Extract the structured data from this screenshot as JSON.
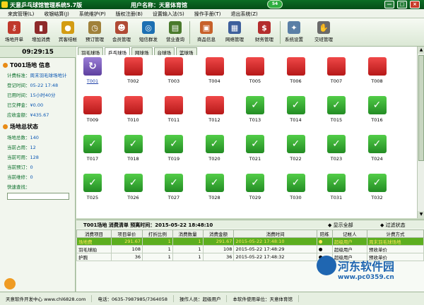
{
  "title": {
    "app": "天意乒乓球馆管理系统5.7版",
    "user": "用户名称：天意体育馆",
    "badge": "54",
    "min": "—",
    "max": "□",
    "close": "×"
  },
  "menu": [
    "来宾管理(L)",
    "收银结算(J)",
    "系统维护(P)",
    "版权注册(B)",
    "设置输入法(S)",
    "操作手册(T)",
    "退出系统(Z)"
  ],
  "toolbar": [
    {
      "label": "场地开单",
      "icon": "key-icon",
      "color": "#c0392b",
      "glyph": "⚷"
    },
    {
      "label": "增加消费",
      "icon": "bottle-icon",
      "color": "#8e2a2a",
      "glyph": "▮"
    },
    {
      "label": "宾客结帐",
      "icon": "coins-icon",
      "color": "#d39c13",
      "glyph": "●"
    },
    {
      "label": "预订管理",
      "icon": "alarm-clock-icon",
      "color": "#a0813a",
      "glyph": "◷"
    },
    {
      "label": "会员管理",
      "icon": "members-icon",
      "color": "#b04a35",
      "glyph": "☻"
    },
    {
      "label": "短信群发",
      "icon": "globe-icon",
      "color": "#1c6fb2",
      "glyph": "◎"
    },
    {
      "label": "营业查询",
      "icon": "pos-icon",
      "color": "#4a7a2c",
      "glyph": "▤"
    },
    {
      "label": "商品信息",
      "icon": "shopping-icon",
      "color": "#c7612a",
      "glyph": "▣"
    },
    {
      "label": "网络管理",
      "icon": "network-icon",
      "color": "#3d5f9c",
      "glyph": "▦"
    },
    {
      "label": "财务管理",
      "icon": "finance-icon",
      "color": "#b42d2d",
      "glyph": "$"
    },
    {
      "label": "系统设置",
      "icon": "tools-icon",
      "color": "#5a7fa6",
      "glyph": "✦"
    },
    {
      "label": "交班管理",
      "icon": "handshake-icon",
      "color": "#6a6a6a",
      "glyph": "✋"
    }
  ],
  "clock": "09:29:15",
  "venue_info": {
    "title": "T001场地 信息",
    "rows": [
      {
        "label": "计费标准：",
        "value": "周末羽毛球场地计"
      },
      {
        "label": "登记时间：",
        "value": "05-22 17:48"
      },
      {
        "label": "已用时间：",
        "value": "15小时40分"
      },
      {
        "label": "已交押金：",
        "value": "¥0.00"
      },
      {
        "label": "应收金额：",
        "value": "¥435.67"
      }
    ]
  },
  "venue_status": {
    "title": "场地总状态",
    "rows": [
      {
        "label": "场地总数：",
        "value": "140"
      },
      {
        "label": "当前占用：",
        "value": "12"
      },
      {
        "label": "当前可用：",
        "value": "128"
      },
      {
        "label": "当前预订：",
        "value": "0"
      },
      {
        "label": "当前维修：",
        "value": "0"
      },
      {
        "label": "快速查找：",
        "value": ""
      }
    ]
  },
  "tabs": [
    "羽毛球场",
    "乒乓球场",
    "网球场",
    "台球场",
    "篮球场"
  ],
  "courts": [
    {
      "id": "T001",
      "state": "selected"
    },
    {
      "id": "T002",
      "state": "busy"
    },
    {
      "id": "T003",
      "state": "busy"
    },
    {
      "id": "T004",
      "state": "busy"
    },
    {
      "id": "T005",
      "state": "busy"
    },
    {
      "id": "T006",
      "state": "busy"
    },
    {
      "id": "T007",
      "state": "busy"
    },
    {
      "id": "T008",
      "state": "busy"
    },
    {
      "id": "T009",
      "state": "busy"
    },
    {
      "id": "T010",
      "state": "busy"
    },
    {
      "id": "T011",
      "state": "busy"
    },
    {
      "id": "T012",
      "state": "busy"
    },
    {
      "id": "T013",
      "state": "free"
    },
    {
      "id": "T014",
      "state": "free"
    },
    {
      "id": "T015",
      "state": "free"
    },
    {
      "id": "T016",
      "state": "free"
    },
    {
      "id": "T017",
      "state": "free"
    },
    {
      "id": "T018",
      "state": "free"
    },
    {
      "id": "T019",
      "state": "free"
    },
    {
      "id": "T020",
      "state": "free"
    },
    {
      "id": "T021",
      "state": "free"
    },
    {
      "id": "T022",
      "state": "free"
    },
    {
      "id": "T023",
      "state": "free"
    },
    {
      "id": "T024",
      "state": "free"
    },
    {
      "id": "T025",
      "state": "free"
    },
    {
      "id": "T026",
      "state": "free"
    },
    {
      "id": "T027",
      "state": "free"
    },
    {
      "id": "T028",
      "state": "free"
    },
    {
      "id": "T029",
      "state": "free"
    },
    {
      "id": "T030",
      "state": "free"
    },
    {
      "id": "T031",
      "state": "free"
    },
    {
      "id": "T032",
      "state": "free"
    }
  ],
  "consumption": {
    "header": "T001场地   消费清单   预离时间：2015-05-22 18:48:10",
    "show_all": "显示全部",
    "filter": "过滤状态",
    "columns": [
      "消费项目",
      "项目单价",
      "打折比例",
      "消费数量",
      "消费金额",
      "消费时间",
      "陪练",
      "记帐人",
      "计费方式"
    ],
    "rows": [
      [
        "场地费",
        "291.67",
        "1",
        "1",
        "291.67",
        "2015-05-22 17:48:10",
        "●",
        "超级用户",
        "周末羽毛球场地"
      ],
      [
        "羽毛球拍",
        "108",
        "1",
        "1",
        "108",
        "2015-05-22 17:48:29",
        "●",
        "超级用户",
        "预收单价"
      ],
      [
        "护腕",
        "36",
        "1",
        "1",
        "36",
        "2015-05-22 17:48:32",
        "●",
        "超级用户",
        "预收单价"
      ]
    ]
  },
  "status": [
    "天意软件开发中心 www.chl6828.com",
    "电话：0635-7987985/7364058",
    "操作人员：超级用户",
    "本软件使用单位：天意体育馆"
  ],
  "watermark": {
    "name": "河东软件园",
    "url": "www.pc0359.cn"
  },
  "colors": {
    "busy": "#d82626",
    "free": "#3cae34",
    "selected": "#7b60c0",
    "highlight": "#5cae1f"
  }
}
